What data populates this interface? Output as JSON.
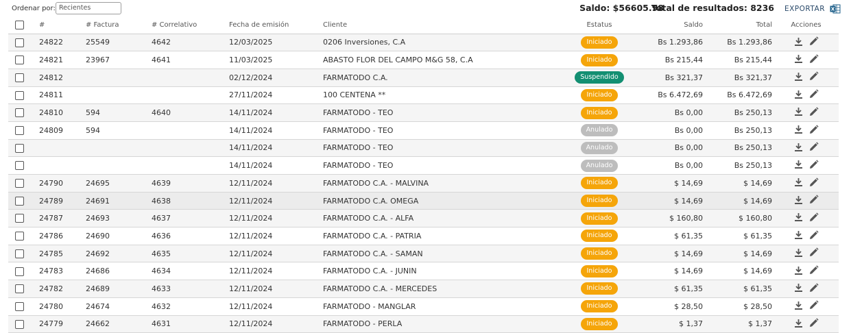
{
  "toolbar": {
    "sort_label": "Ordenar por:",
    "sort_value": "Recientes",
    "saldo": "Saldo: $56605.98",
    "total_results": "Total de resultados: 8236",
    "export_label": "EXPORTAR"
  },
  "colors": {
    "Iniciado": "#f5a50a",
    "Suspendido": "#138f72",
    "Anulado": "#bdbdbd"
  },
  "icons": {
    "export": "excel-icon",
    "download": "download-icon",
    "edit": "pencil-icon"
  },
  "table": {
    "headers": [
      "#",
      "# Factura",
      "# Correlativo",
      "Fecha de emisión",
      "Cliente",
      "Estatus",
      "Saldo",
      "Total",
      "Acciones"
    ],
    "rows": [
      {
        "id": "24822",
        "factura": "25549",
        "correlativo": "4642",
        "fecha": "12/03/2025",
        "cliente": "0206 Inversiones, C.A",
        "estatus": "Iniciado",
        "saldo": "Bs 1.293,86",
        "total": "Bs 1.293,86"
      },
      {
        "id": "24821",
        "factura": "23967",
        "correlativo": "4641",
        "fecha": "11/03/2025",
        "cliente": "ABASTO FLOR DEL CAMPO M&G 58, C.A",
        "estatus": "Iniciado",
        "saldo": "Bs 215,44",
        "total": "Bs 215,44"
      },
      {
        "id": "24812",
        "factura": "",
        "correlativo": "",
        "fecha": "02/12/2024",
        "cliente": "FARMATODO C.A.",
        "estatus": "Suspendido",
        "saldo": "Bs 321,37",
        "total": "Bs 321,37"
      },
      {
        "id": "24811",
        "factura": "",
        "correlativo": "",
        "fecha": "27/11/2024",
        "cliente": "100 CENTENA **",
        "estatus": "Iniciado",
        "saldo": "Bs 6.472,69",
        "total": "Bs 6.472,69"
      },
      {
        "id": "24810",
        "factura": "594",
        "correlativo": "4640",
        "fecha": "14/11/2024",
        "cliente": "FARMATODO - TEO",
        "estatus": "Iniciado",
        "saldo": "Bs 0,00",
        "total": "Bs 250,13"
      },
      {
        "id": "24809",
        "factura": "594",
        "correlativo": "",
        "fecha": "14/11/2024",
        "cliente": "FARMATODO - TEO",
        "estatus": "Anulado",
        "saldo": "Bs 0,00",
        "total": "Bs 250,13"
      },
      {
        "id": "",
        "factura": "",
        "correlativo": "",
        "fecha": "14/11/2024",
        "cliente": "FARMATODO - TEO",
        "estatus": "Anulado",
        "saldo": "Bs 0,00",
        "total": "Bs 250,13"
      },
      {
        "id": "",
        "factura": "",
        "correlativo": "",
        "fecha": "14/11/2024",
        "cliente": "FARMATODO - TEO",
        "estatus": "Anulado",
        "saldo": "Bs 0,00",
        "total": "Bs 250,13"
      },
      {
        "id": "24790",
        "factura": "24695",
        "correlativo": "4639",
        "fecha": "12/11/2024",
        "cliente": "FARMATODO C.A. - MALVINA",
        "estatus": "Iniciado",
        "saldo": "$ 14,69",
        "total": "$ 14,69"
      },
      {
        "id": "24789",
        "factura": "24691",
        "correlativo": "4638",
        "fecha": "12/11/2024",
        "cliente": "FARMATODO C.A. OMEGA",
        "estatus": "Iniciado",
        "saldo": "$ 14,69",
        "total": "$ 14,69"
      },
      {
        "id": "24787",
        "factura": "24693",
        "correlativo": "4637",
        "fecha": "12/11/2024",
        "cliente": "FARMATODO C.A. - ALFA",
        "estatus": "Iniciado",
        "saldo": "$ 160,80",
        "total": "$ 160,80"
      },
      {
        "id": "24786",
        "factura": "24690",
        "correlativo": "4636",
        "fecha": "12/11/2024",
        "cliente": "FARMATODO C.A. - PATRIA",
        "estatus": "Iniciado",
        "saldo": "$ 61,35",
        "total": "$ 61,35"
      },
      {
        "id": "24785",
        "factura": "24692",
        "correlativo": "4635",
        "fecha": "12/11/2024",
        "cliente": "FARMATODO C.A. - SAMAN",
        "estatus": "Iniciado",
        "saldo": "$ 14,69",
        "total": "$ 14,69"
      },
      {
        "id": "24783",
        "factura": "24686",
        "correlativo": "4634",
        "fecha": "12/11/2024",
        "cliente": "FARMATODO C.A. - JUNIN",
        "estatus": "Iniciado",
        "saldo": "$ 14,69",
        "total": "$ 14,69"
      },
      {
        "id": "24782",
        "factura": "24689",
        "correlativo": "4633",
        "fecha": "12/11/2024",
        "cliente": "FARMATODO C.A. - MERCEDES",
        "estatus": "Iniciado",
        "saldo": "$ 61,35",
        "total": "$ 61,35"
      },
      {
        "id": "24780",
        "factura": "24674",
        "correlativo": "4632",
        "fecha": "12/11/2024",
        "cliente": "FARMATODO - MANGLAR",
        "estatus": "Iniciado",
        "saldo": "$ 28,50",
        "total": "$ 28,50"
      },
      {
        "id": "24779",
        "factura": "24662",
        "correlativo": "4631",
        "fecha": "12/11/2024",
        "cliente": "FARMATODO - PERLA",
        "estatus": "Iniciado",
        "saldo": "$ 1,37",
        "total": "$ 1,37"
      }
    ]
  }
}
